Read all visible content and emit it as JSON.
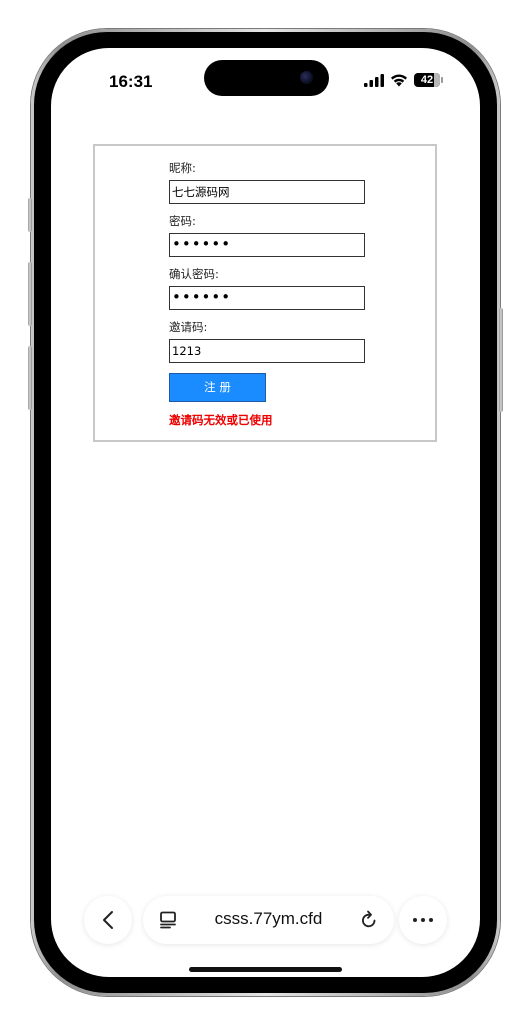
{
  "status_bar": {
    "time": "16:31",
    "battery_level": "42",
    "icons": [
      "cellular-signal-icon",
      "wifi-icon",
      "battery-icon"
    ]
  },
  "form": {
    "nickname_label": "昵称:",
    "nickname_value": "七七源码网",
    "password_label": "密码:",
    "password_value": "••••••",
    "confirm_password_label": "确认密码:",
    "confirm_password_value": "••••••",
    "invite_code_label": "邀请码:",
    "invite_code_value": "1213",
    "submit_label": "注 册",
    "error_message": "邀请码无效或已使用"
  },
  "browser": {
    "url": "csss.77ym.cfd",
    "icons": [
      "back-icon",
      "tabs-icon",
      "reload-icon",
      "more-icon"
    ]
  },
  "colors": {
    "submit_button": "#1a8cff",
    "error_text": "#ee0000"
  }
}
